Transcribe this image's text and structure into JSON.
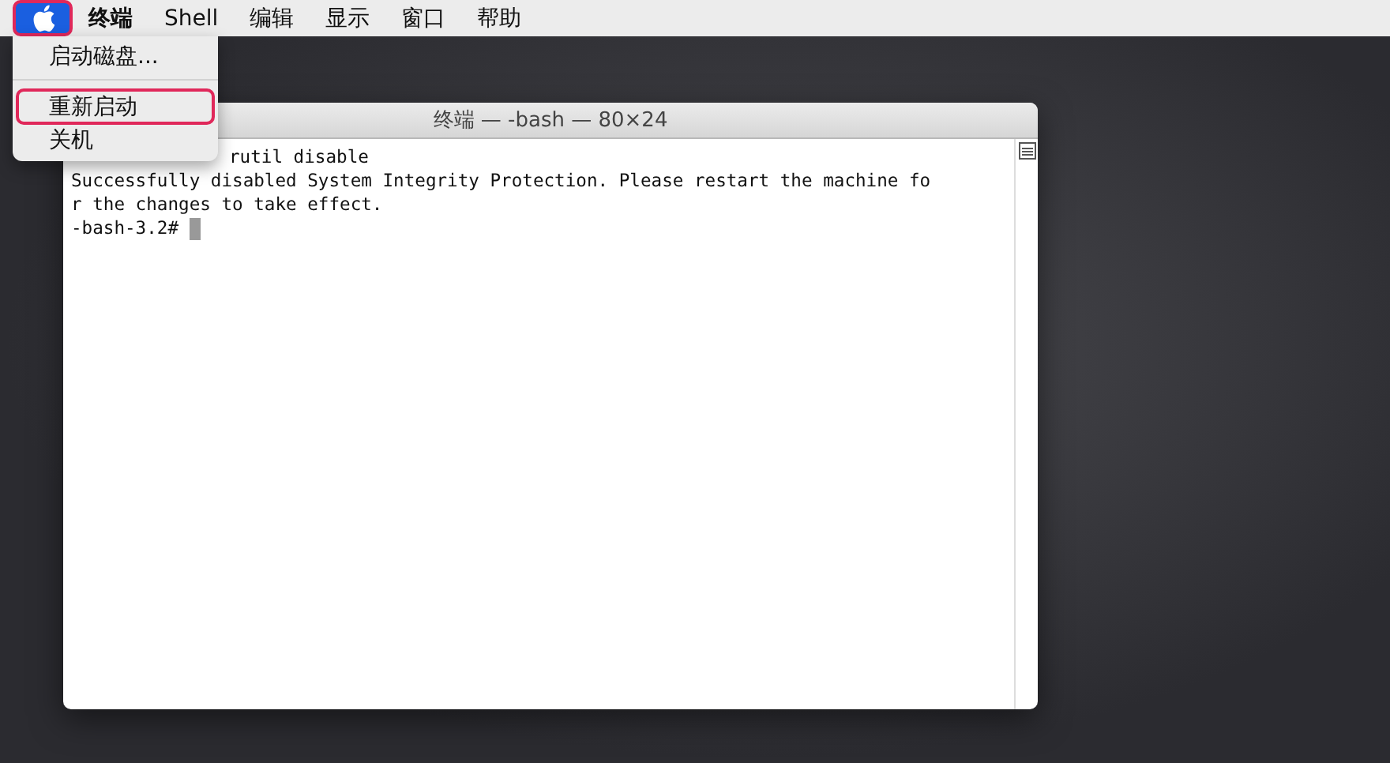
{
  "menu_bar": {
    "apple_menu": {
      "selected": true,
      "outlined": true
    },
    "items": [
      {
        "label": "终端",
        "bold": true
      },
      {
        "label": "Shell",
        "bold": false
      },
      {
        "label": "编辑",
        "bold": false
      },
      {
        "label": "显示",
        "bold": false
      },
      {
        "label": "窗口",
        "bold": false
      },
      {
        "label": "帮助",
        "bold": false
      }
    ]
  },
  "apple_dropdown": {
    "items": [
      {
        "kind": "item",
        "label": "启动磁盘...",
        "outlined": false
      },
      {
        "kind": "separator"
      },
      {
        "kind": "item",
        "label": "重新启动",
        "outlined": true
      },
      {
        "kind": "item",
        "label": "关机",
        "outlined": false
      }
    ]
  },
  "terminal": {
    "title": "终端 — -bash — 80×24",
    "lines": [
      {
        "text": "rutil disable",
        "partly_covered": true
      },
      {
        "text": "Successfully disabled System Integrity Protection. Please restart the machine fo",
        "partly_covered": false
      },
      {
        "text": "r the changes to take effect.",
        "partly_covered": false
      },
      {
        "text": "-bash-3.2#",
        "partly_covered": false,
        "cursor": true
      }
    ]
  }
}
